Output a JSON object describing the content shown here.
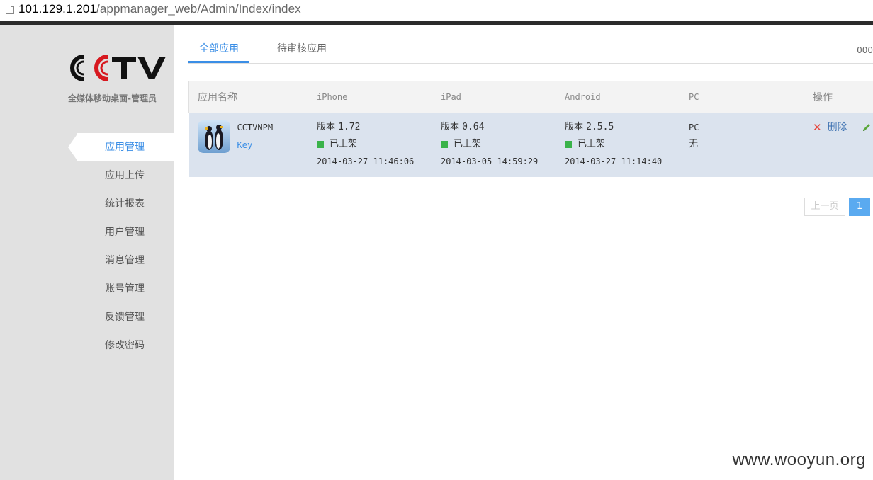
{
  "browser": {
    "url_host": "101.129.1.201",
    "url_path": "/appmanager_web/Admin/Index/index"
  },
  "brand": {
    "logo_text": "CCTV",
    "subtitle": "全媒体移动桌面-管理员"
  },
  "sidebar": {
    "items": [
      {
        "label": "应用管理",
        "active": true
      },
      {
        "label": "应用上传"
      },
      {
        "label": "统计报表"
      },
      {
        "label": "用户管理"
      },
      {
        "label": "消息管理"
      },
      {
        "label": "账号管理"
      },
      {
        "label": "反馈管理"
      },
      {
        "label": "修改密码"
      }
    ]
  },
  "tabs": [
    {
      "label": "全部应用",
      "active": true
    },
    {
      "label": "待审核应用"
    }
  ],
  "tab_corner": "000",
  "table": {
    "headers": [
      "应用名称",
      "iPhone",
      "iPad",
      "Android",
      "PC",
      "操作"
    ],
    "rows": [
      {
        "name": "CCTVNPM",
        "key_label": "Key",
        "iphone": {
          "version_label": "版本",
          "version": "1.72",
          "status": "已上架",
          "date": "2014-03-27 11:46:06"
        },
        "ipad": {
          "version_label": "版本",
          "version": "0.64",
          "status": "已上架",
          "date": "2014-03-05 14:59:29"
        },
        "android": {
          "version_label": "版本",
          "version": "2.5.5",
          "status": "已上架",
          "date": "2014-03-27 11:14:40"
        },
        "pc": {
          "line1": "PC",
          "line2": "无"
        },
        "ops": {
          "delete_label": "删除"
        }
      }
    ]
  },
  "pagination": {
    "prev_label": "上一页",
    "current": "1"
  },
  "watermark": "www.wooyun.org",
  "colors": {
    "accent": "#3a8ee6",
    "status_green": "#3ab34a",
    "row_bg": "#dbe3ee",
    "sidebar_bg": "#e1e1e1",
    "delete_red": "#e8443a"
  }
}
